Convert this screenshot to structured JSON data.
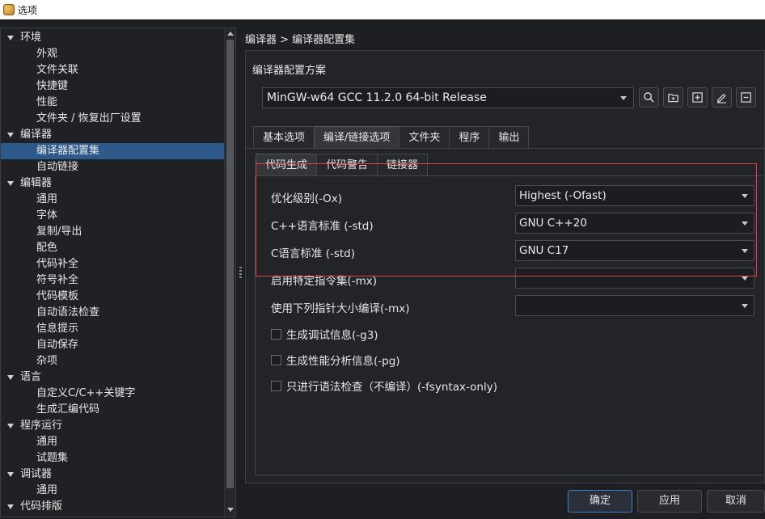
{
  "window": {
    "title": "选项"
  },
  "tree": {
    "items": [
      {
        "label": "环境",
        "level": 0
      },
      {
        "label": "外观",
        "level": 1
      },
      {
        "label": "文件关联",
        "level": 1
      },
      {
        "label": "快捷键",
        "level": 1
      },
      {
        "label": "性能",
        "level": 1
      },
      {
        "label": "文件夹 / 恢复出厂设置",
        "level": 1
      },
      {
        "label": "编译器",
        "level": 0
      },
      {
        "label": "编译器配置集",
        "level": 1,
        "selected": true
      },
      {
        "label": "自动链接",
        "level": 1
      },
      {
        "label": "编辑器",
        "level": 0
      },
      {
        "label": "通用",
        "level": 1
      },
      {
        "label": "字体",
        "level": 1
      },
      {
        "label": "复制/导出",
        "level": 1
      },
      {
        "label": "配色",
        "level": 1
      },
      {
        "label": "代码补全",
        "level": 1
      },
      {
        "label": "符号补全",
        "level": 1
      },
      {
        "label": "代码模板",
        "level": 1
      },
      {
        "label": "自动语法检查",
        "level": 1
      },
      {
        "label": "信息提示",
        "level": 1
      },
      {
        "label": "自动保存",
        "level": 1
      },
      {
        "label": "杂项",
        "level": 1
      },
      {
        "label": "语言",
        "level": 0
      },
      {
        "label": "自定义C/C++关键字",
        "level": 1
      },
      {
        "label": "生成汇编代码",
        "level": 1
      },
      {
        "label": "程序运行",
        "level": 0
      },
      {
        "label": "通用",
        "level": 1
      },
      {
        "label": "试题集",
        "level": 1
      },
      {
        "label": "调试器",
        "level": 0
      },
      {
        "label": "通用",
        "level": 1
      },
      {
        "label": "代码排版",
        "level": 0
      }
    ]
  },
  "breadcrumb": "编译器 > 编译器配置集",
  "config": {
    "group_title": "编译器配置方案",
    "selected": "MinGW-w64 GCC 11.2.0 64-bit Release",
    "tool_icons": [
      "search-icon",
      "folder-add-icon",
      "plus-icon",
      "edit-icon",
      "minus-icon"
    ]
  },
  "tabs": [
    "基本选项",
    "编译/链接选项",
    "文件夹",
    "程序",
    "输出"
  ],
  "active_tab": 1,
  "subtabs": [
    "代码生成",
    "代码警告",
    "链接器"
  ],
  "active_subtab": 0,
  "options": [
    {
      "label": "优化级别(-Ox)",
      "value": "Highest (-Ofast)"
    },
    {
      "label": "C++语言标准 (-std)",
      "value": "GNU C++20"
    },
    {
      "label": "C语言标准 (-std)",
      "value": "GNU C17"
    },
    {
      "label": "启用特定指令集(-mx)",
      "value": ""
    },
    {
      "label": "使用下列指针大小编译(-mx)",
      "value": ""
    }
  ],
  "checks": [
    {
      "label": "生成调试信息(-g3)",
      "checked": false
    },
    {
      "label": "生成性能分析信息(-pg)",
      "checked": false
    },
    {
      "label": "只进行语法检查（不编译）(-fsyntax-only)",
      "checked": false
    }
  ],
  "buttons": {
    "ok": "确定",
    "apply": "应用",
    "cancel": "取消"
  },
  "colors": {
    "selection": "#2d5a8a",
    "highlight_box": "#e0414c",
    "primary_border": "#3d7fc5"
  }
}
